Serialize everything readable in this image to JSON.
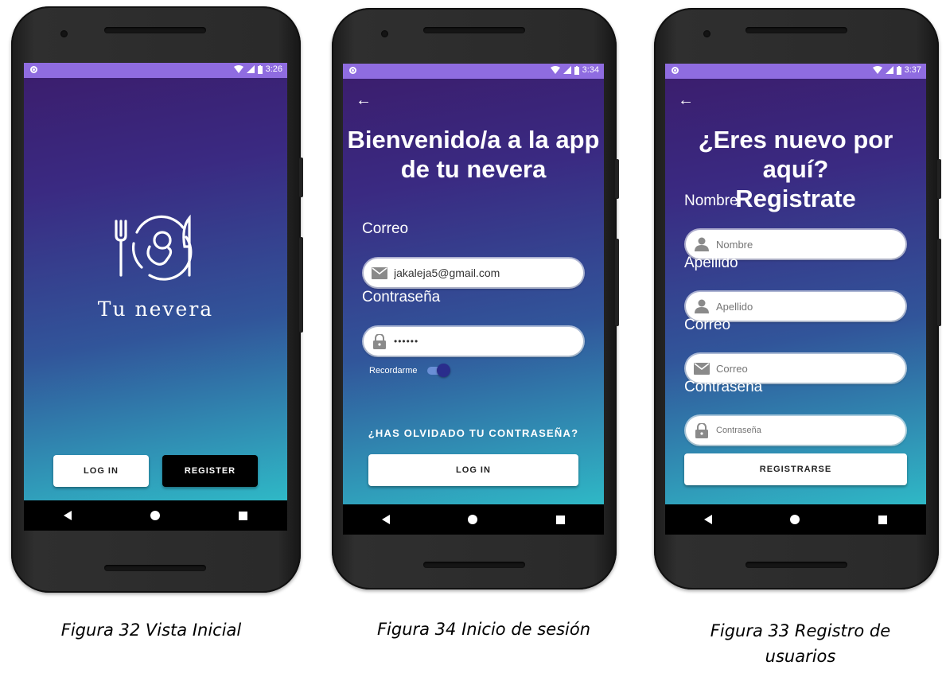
{
  "phone1": {
    "status_time": "3:26",
    "app_name": "Tu nevera",
    "login_label": "LOG IN",
    "register_label": "REGISTER"
  },
  "phone2": {
    "status_time": "3:34",
    "title_line1": "Bienvenido/a a la app",
    "title_line2": "de tu nevera",
    "email_label": "Correo",
    "email_value": "jakaleja5@gmail.com",
    "password_label": "Contraseña",
    "password_value": "••••••",
    "remember_label": "Recordarme",
    "forgot_label": "¿HAS OLVIDADO TU CONTRASEÑA?",
    "login_label": "LOG IN"
  },
  "phone3": {
    "status_time": "3:37",
    "title_line1": "¿Eres nuevo por aquí?",
    "title_line2": "Registrate",
    "name_label": "Nombre",
    "name_placeholder": "Nombre",
    "surname_label": "Apellido",
    "surname_placeholder": "Apellido",
    "email_label": "Correo",
    "email_placeholder": "Correo",
    "password_label": "Contraseña",
    "password_placeholder": "Contraseña",
    "register_label": "REGISTRARSE"
  },
  "captions": {
    "fig1": "Figura 32 Vista Inicial",
    "fig2": "Figura 34 Inicio de sesión",
    "fig3_line1": "Figura 33 Registro de",
    "fig3_line2": "usuarios"
  },
  "colors": {
    "statusbar": "#8f6ce0",
    "gradient_top": "#3b1e6e",
    "gradient_bottom": "#2fb8c6",
    "toggle_thumb": "#2a2d8c"
  },
  "icons": {
    "email": "envelope-icon",
    "lock": "lock-icon",
    "person": "person-icon",
    "back": "back-arrow-icon",
    "logo": "plate-fork-knife-icon"
  }
}
